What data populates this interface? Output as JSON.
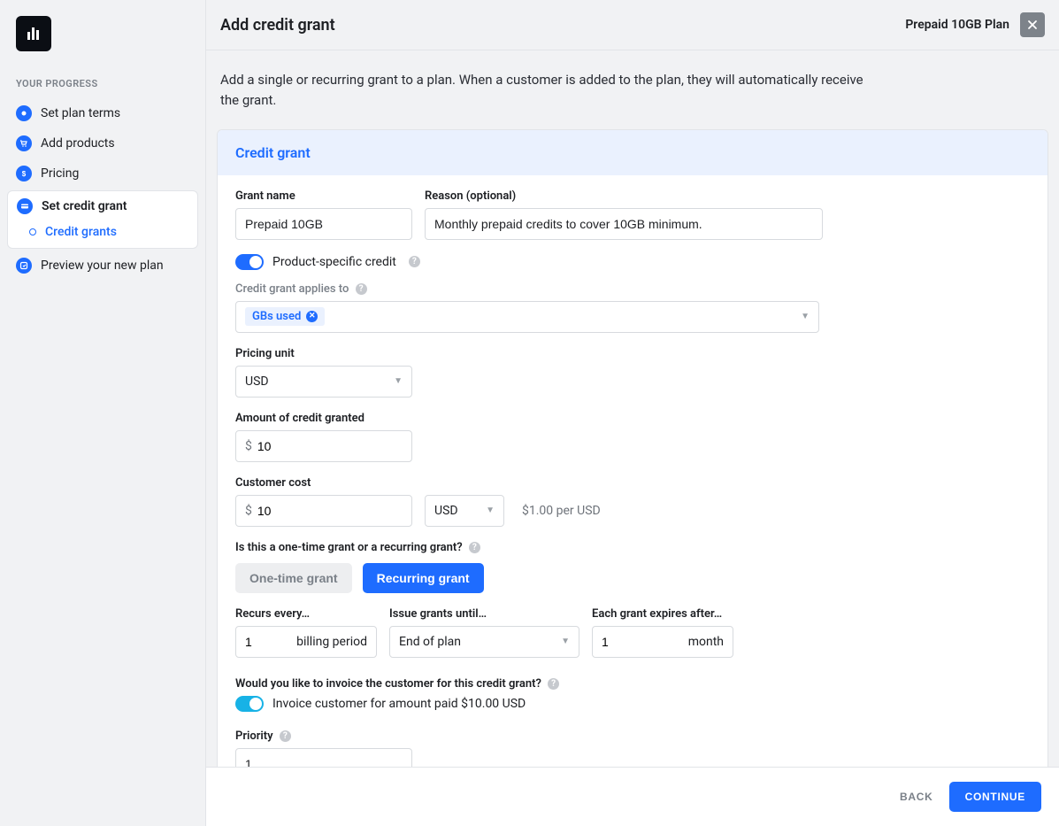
{
  "sidebar": {
    "progress_label": "YOUR PROGRESS",
    "steps": [
      {
        "label": "Set plan terms",
        "icon": "plan-icon"
      },
      {
        "label": "Add products",
        "icon": "cart-icon"
      },
      {
        "label": "Pricing",
        "icon": "dollar-icon"
      },
      {
        "label": "Set credit grant",
        "icon": "card-icon",
        "active": true,
        "substeps": [
          {
            "label": "Credit grants"
          }
        ]
      },
      {
        "label": "Preview your new plan",
        "icon": "preview-icon"
      }
    ]
  },
  "topbar": {
    "title": "Add credit grant",
    "plan_name": "Prepaid 10GB Plan"
  },
  "intro": "Add a single or recurring grant to a plan. When a customer is added to the plan, they will automatically receive the grant.",
  "card": {
    "heading": "Credit grant",
    "grant_name_label": "Grant name",
    "grant_name": "Prepaid 10GB",
    "reason_label": "Reason (optional)",
    "reason": "Monthly prepaid credits to cover 10GB minimum.",
    "product_specific_toggle_label": "Product-specific credit",
    "product_specific_toggle": true,
    "applies_to_label": "Credit grant applies to",
    "applies_to_chip": "GBs used",
    "pricing_unit_label": "Pricing unit",
    "pricing_unit": "USD",
    "amount_label": "Amount of credit granted",
    "amount_currency": "$",
    "amount_value": "10",
    "cost_label": "Customer cost",
    "cost_currency": "$",
    "cost_value": "10",
    "cost_unit": "USD",
    "cost_per_text": "$1.00 per USD",
    "type_question": "Is this a one-time grant or a recurring grant?",
    "type_options": {
      "one_time": "One-time grant",
      "recurring": "Recurring grant"
    },
    "type_selected": "recurring",
    "recurs_label": "Recurs every…",
    "recurs_value": "1",
    "recurs_unit": "billing period",
    "until_label": "Issue grants until…",
    "until_value": "End of plan",
    "expires_label": "Each grant expires after…",
    "expires_value": "1",
    "expires_unit": "month",
    "invoice_question": "Would you like to invoice the customer for this credit grant?",
    "invoice_toggle": true,
    "invoice_toggle_label": "Invoice customer for amount paid $10.00 USD",
    "priority_label": "Priority",
    "priority_value": "1"
  },
  "footer": {
    "back": "BACK",
    "continue": "CONTINUE"
  }
}
